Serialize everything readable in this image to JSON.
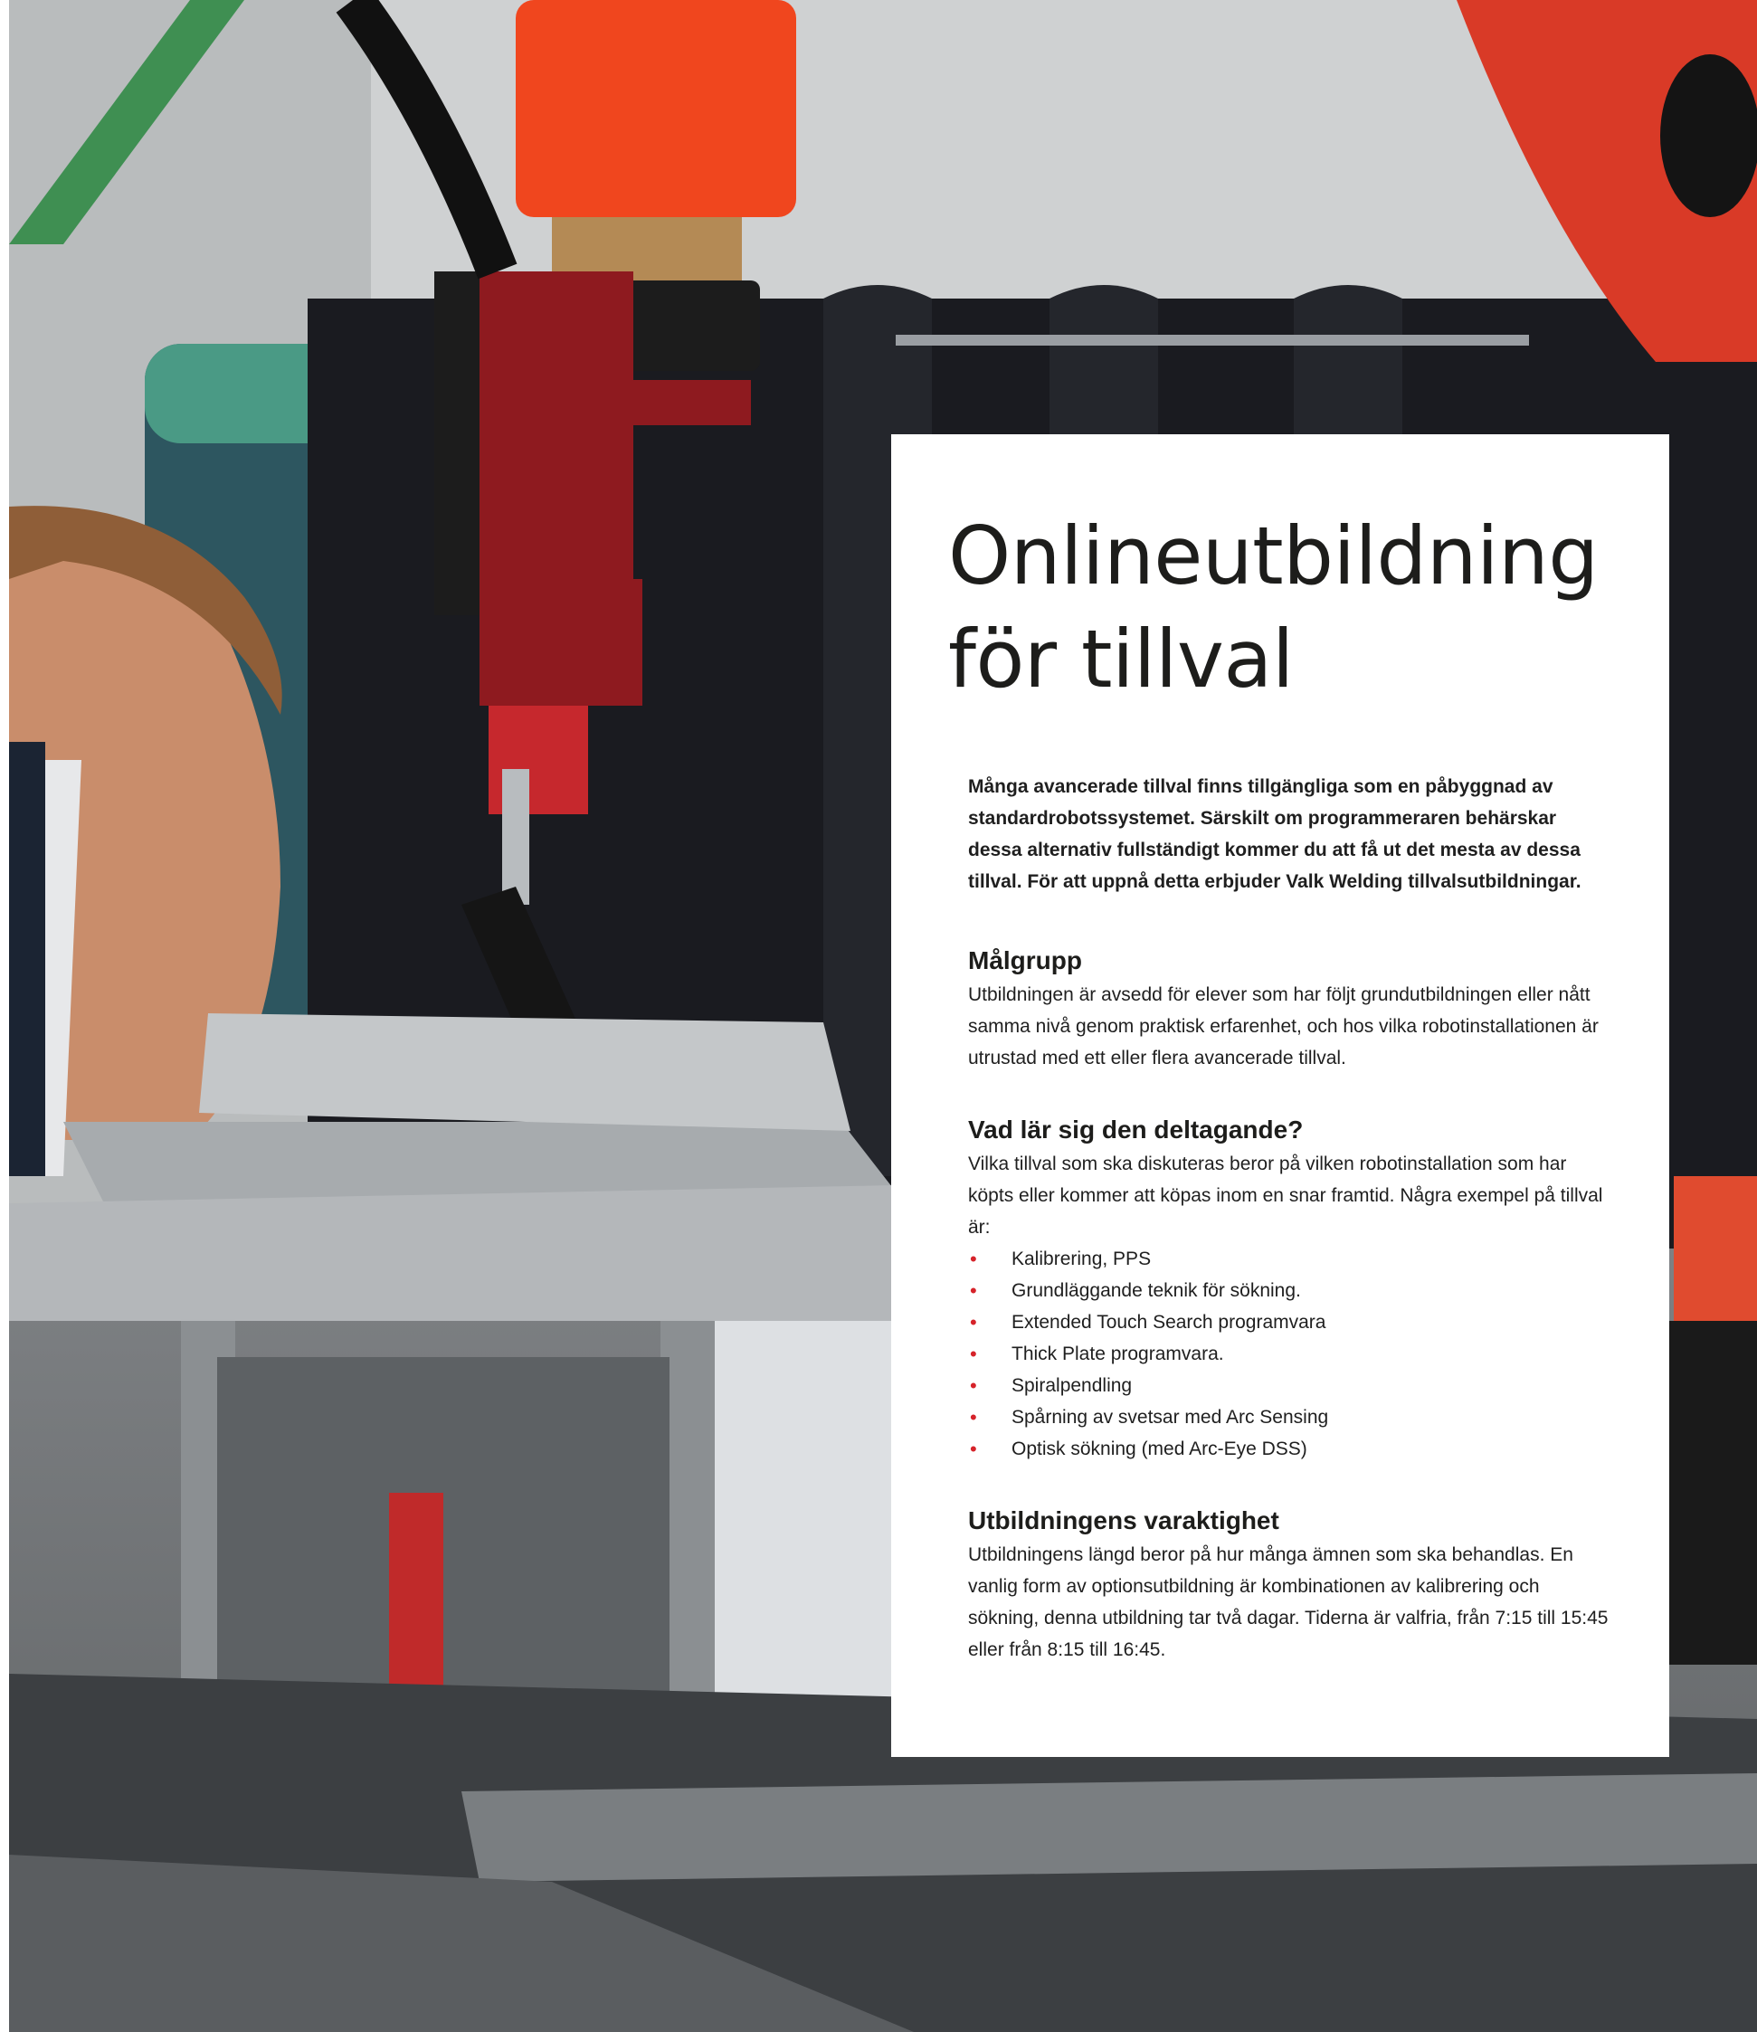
{
  "title": "Onlineutbildning för tillval",
  "intro": "Många avancerade tillval finns tillgängliga som en påbyggnad av standardrobotssystemet. Särskilt om programmeraren behärskar dessa alternativ fullständigt kommer du att få ut det mesta av dessa tillval. För att uppnå detta erbjuder Valk Welding tillvalsutbildningar.",
  "sections": [
    {
      "heading": "Målgrupp",
      "text": "Utbildningen är avsedd för elever som har följt grundutbildningen eller nått samma nivå genom praktisk erfarenhet, och hos vilka robotinstallationen är utrustad med ett eller flera avancerade tillval."
    },
    {
      "heading": "Vad lär sig den deltagande?",
      "text": "Vilka tillval som ska diskuteras beror på vilken robotinstallation som har köpts eller kommer att köpas inom en snar framtid. Några exempel på tillval är:",
      "bullets": [
        "Kalibrering, PPS",
        "Grundläggande teknik för sökning.",
        "Extended Touch Search programvara",
        "Thick Plate programvara.",
        "Spiralpendling",
        "Spårning av svetsar med Arc Sensing",
        "Optisk sökning (med Arc-Eye DSS)"
      ]
    },
    {
      "heading": "Utbildningens varaktighet",
      "text": "Utbildningens längd beror på hur många ämnen som ska behandlas. En vanlig form av optionsutbildning är kombinationen av kalibrering och sökning, denna utbildning tar två dagar. Tiderna är valfria, från 7:15 till 15:45 eller från 8:15 till 16:45."
    }
  ],
  "colors": {
    "bullet": "#d6232a",
    "robot_orange": "#f0461e",
    "robot_red": "#8e1a1f"
  }
}
